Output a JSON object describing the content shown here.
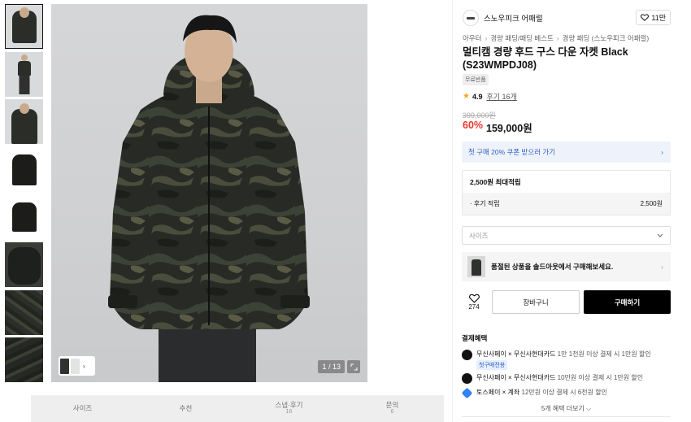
{
  "thumbnails": [
    {
      "name": "thumb-front-1",
      "selected": true
    },
    {
      "name": "thumb-full-body",
      "selected": false
    },
    {
      "name": "thumb-front-2",
      "selected": false
    },
    {
      "name": "thumb-flat-front",
      "selected": false
    },
    {
      "name": "thumb-flat-back",
      "selected": false
    },
    {
      "name": "thumb-detail-hood",
      "selected": false
    },
    {
      "name": "thumb-detail-fabric",
      "selected": false
    },
    {
      "name": "thumb-detail-sleeve",
      "selected": false
    }
  ],
  "gallery": {
    "counter": "1 / 13",
    "mini_chevron": "›"
  },
  "tabs": [
    {
      "label": "사이즈",
      "sub": ""
    },
    {
      "label": "추천",
      "sub": ""
    },
    {
      "label": "스냅·후기",
      "sub": "16"
    },
    {
      "label": "문의",
      "sub": "6"
    }
  ],
  "brand": {
    "name": "스노우피크 어패럴",
    "likes": "11만"
  },
  "breadcrumb": [
    "아우터",
    "경량 패딩/패딩 베스트",
    "경량 패딩 (스노우피크 어패럴)"
  ],
  "product": {
    "title": "멀티캠 경량 후드 구스 다운 자켓 Black (S23WMPDJ08)",
    "tag": "무료반품",
    "rating": "4.9",
    "reviews": "후기 16개",
    "original_price": "399,000원",
    "discount": "60%",
    "price": "159,000원"
  },
  "coupon": {
    "label": "첫 구매 20% 쿠폰 받으러 가기"
  },
  "points": {
    "max": "2,500원 최대적립",
    "review_label": "· 후기 적립",
    "review_value": "2,500원"
  },
  "size_select": {
    "placeholder": "사이즈"
  },
  "soldout": {
    "label": "품절된 상품을 솔드아웃에서 구매해보세요."
  },
  "actions": {
    "like_count": "274",
    "cart": "장바구니",
    "buy": "구매하기"
  },
  "benefits": {
    "title": "결제혜택",
    "items": [
      {
        "name": "무신사페이 × 무신사현대카드",
        "desc": "1만 1천원 이상 결제 시 1만원 할인",
        "badge": "첫구매전용"
      },
      {
        "name": "무신사페이 × 무신사현대카드",
        "desc": "10만원 이상 결제 시 1만원 할인",
        "badge": ""
      },
      {
        "name": "토스페이 × 계좌",
        "desc": "12만원 이상 결제 시 6천원 할인",
        "badge": ""
      }
    ],
    "more": "5개 혜택 더보기 ⌵"
  },
  "colors": {
    "discount": "#f1352b",
    "coupon_text": "#2e5ec2",
    "coupon_bg": "#eef3fb",
    "buy_button": "#000000"
  }
}
